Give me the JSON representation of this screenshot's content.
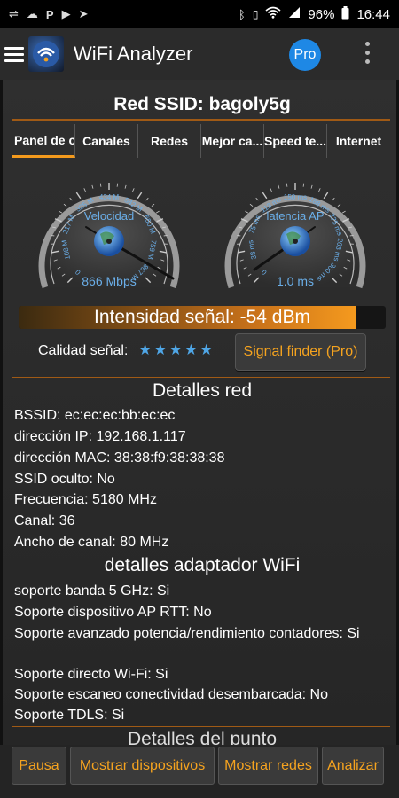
{
  "status_bar": {
    "left_icons": [
      "usb-icon",
      "cloud-icon",
      "paypal-icon",
      "play-store-icon",
      "telegram-icon"
    ],
    "battery": "96%",
    "time": "16:44"
  },
  "app_bar": {
    "title": "WiFi Analyzer",
    "pro_label": "Pro"
  },
  "ssid": "Red SSID: bagoly5g",
  "tabs": [
    "Panel de c",
    "Canales",
    "Redes",
    "Mejor ca...",
    "Speed te...",
    "Internet"
  ],
  "gauges": {
    "speed": {
      "label": "Velocidad",
      "value": "866 Mbps",
      "ticks": [
        "0",
        "108 M",
        "217 M",
        "325 M",
        "434 M",
        "542 M",
        "650 M",
        "759 M",
        "867 M"
      ]
    },
    "latency": {
      "label": "latencia AP",
      "value": "1.0 ms",
      "ticks": [
        "0",
        "38 ms",
        "75 ms",
        "113 ms",
        "150 ms",
        "188 ms",
        "225 ms",
        "263 ms",
        "300 ms"
      ]
    }
  },
  "signal": {
    "text": "Intensidad señal: -54 dBm",
    "fill_fraction": 0.92,
    "quality_label": "Calidad señal:",
    "stars": 5,
    "finder_button": "Signal finder (Pro)"
  },
  "network_details": {
    "title": "Detalles red",
    "lines": [
      "BSSID: ec:ec:ec:bb:ec:ec",
      "dirección IP: 192.168.1.117",
      "dirección MAC: 38:38:f9:38:38:38",
      "SSID oculto: No",
      "Frecuencia: 5180 MHz",
      "Canal: 36",
      "Ancho de canal: 80 MHz"
    ]
  },
  "adapter_details": {
    "title": "detalles adaptador WiFi",
    "lines": [
      "soporte banda 5 GHz: Si",
      "Soporte dispositivo AP RTT: No",
      "Soporte avanzado potencia/rendimiento contadores: Si",
      "Soporte directo Wi-Fi: Si",
      "Soporte escaneo conectividad desembarcada: No",
      "Soporte TDLS: Si"
    ]
  },
  "next_section_partial": "Detalles del punto",
  "bottom_buttons": [
    "Pausa",
    "Mostrar dispositivos",
    "Mostrar redes",
    "Analizar"
  ],
  "colors": {
    "accent_orange": "#f5a31f",
    "gauge_blue": "#6aaee8",
    "pro_blue": "#1e88e5",
    "divider": "#a05a15"
  }
}
